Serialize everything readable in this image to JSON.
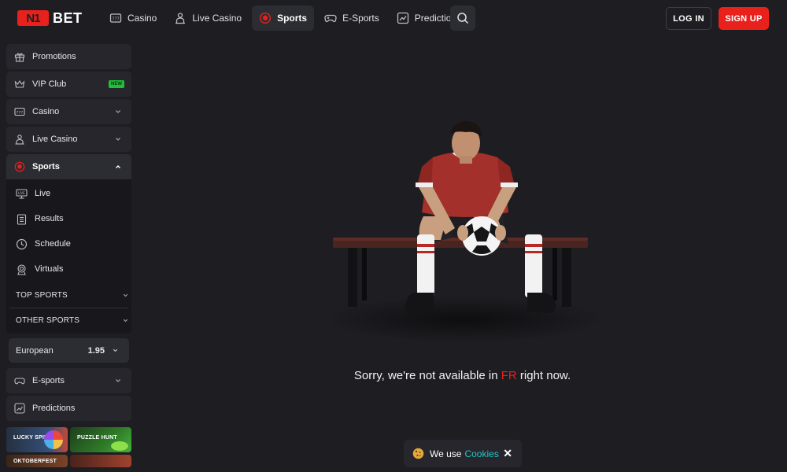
{
  "header": {
    "logo_mark": "N1",
    "logo_text": "BET",
    "nav": [
      {
        "label": "Casino",
        "icon": "slot-machine-icon",
        "active": false
      },
      {
        "label": "Live Casino",
        "icon": "dealer-icon",
        "active": false
      },
      {
        "label": "Sports",
        "icon": "soccer-ball-icon",
        "active": true
      },
      {
        "label": "E-Sports",
        "icon": "gamepad-icon",
        "active": false
      },
      {
        "label": "Predictions",
        "icon": "trend-chart-icon",
        "active": false
      }
    ],
    "login_label": "LOG IN",
    "signup_label": "SIGN UP"
  },
  "sidebar": {
    "items": [
      {
        "label": "Promotions",
        "icon": "gift-icon"
      },
      {
        "label": "VIP Club",
        "icon": "crown-icon",
        "badge": "NEW"
      },
      {
        "label": "Casino",
        "icon": "slot-machine-icon"
      },
      {
        "label": "Live Casino",
        "icon": "dealer-icon"
      },
      {
        "label": "Sports",
        "icon": "soccer-ball-icon",
        "expanded": true
      },
      {
        "label": "E-sports",
        "icon": "gamepad-icon"
      },
      {
        "label": "Predictions",
        "icon": "trend-chart-icon"
      }
    ],
    "sports_sub": [
      {
        "label": "Live",
        "icon": "live-tv-icon"
      },
      {
        "label": "Results",
        "icon": "clipboard-icon"
      },
      {
        "label": "Schedule",
        "icon": "clock-icon"
      },
      {
        "label": "Virtuals",
        "icon": "virtual-headset-icon"
      }
    ],
    "top_sports": "TOP SPORTS",
    "other_sports": "OTHER SPORTS",
    "odds_format": {
      "label": "European",
      "value": "1.95"
    },
    "promos": [
      "LUCKY SPIN",
      "PUZZLE HUNT",
      "OKTOBERFEST",
      ""
    ]
  },
  "main": {
    "message_before": "Sorry, we're not available in ",
    "country": "FR",
    "message_after": " right now."
  },
  "cookie": {
    "text": "We use",
    "link": "Cookies",
    "close": "✕"
  },
  "colors": {
    "accent": "#e8211d",
    "background": "#1e1e22",
    "sidebar_item": "#26262c",
    "cookie_link": "#23c6c8",
    "new_badge": "#1fc13a"
  }
}
